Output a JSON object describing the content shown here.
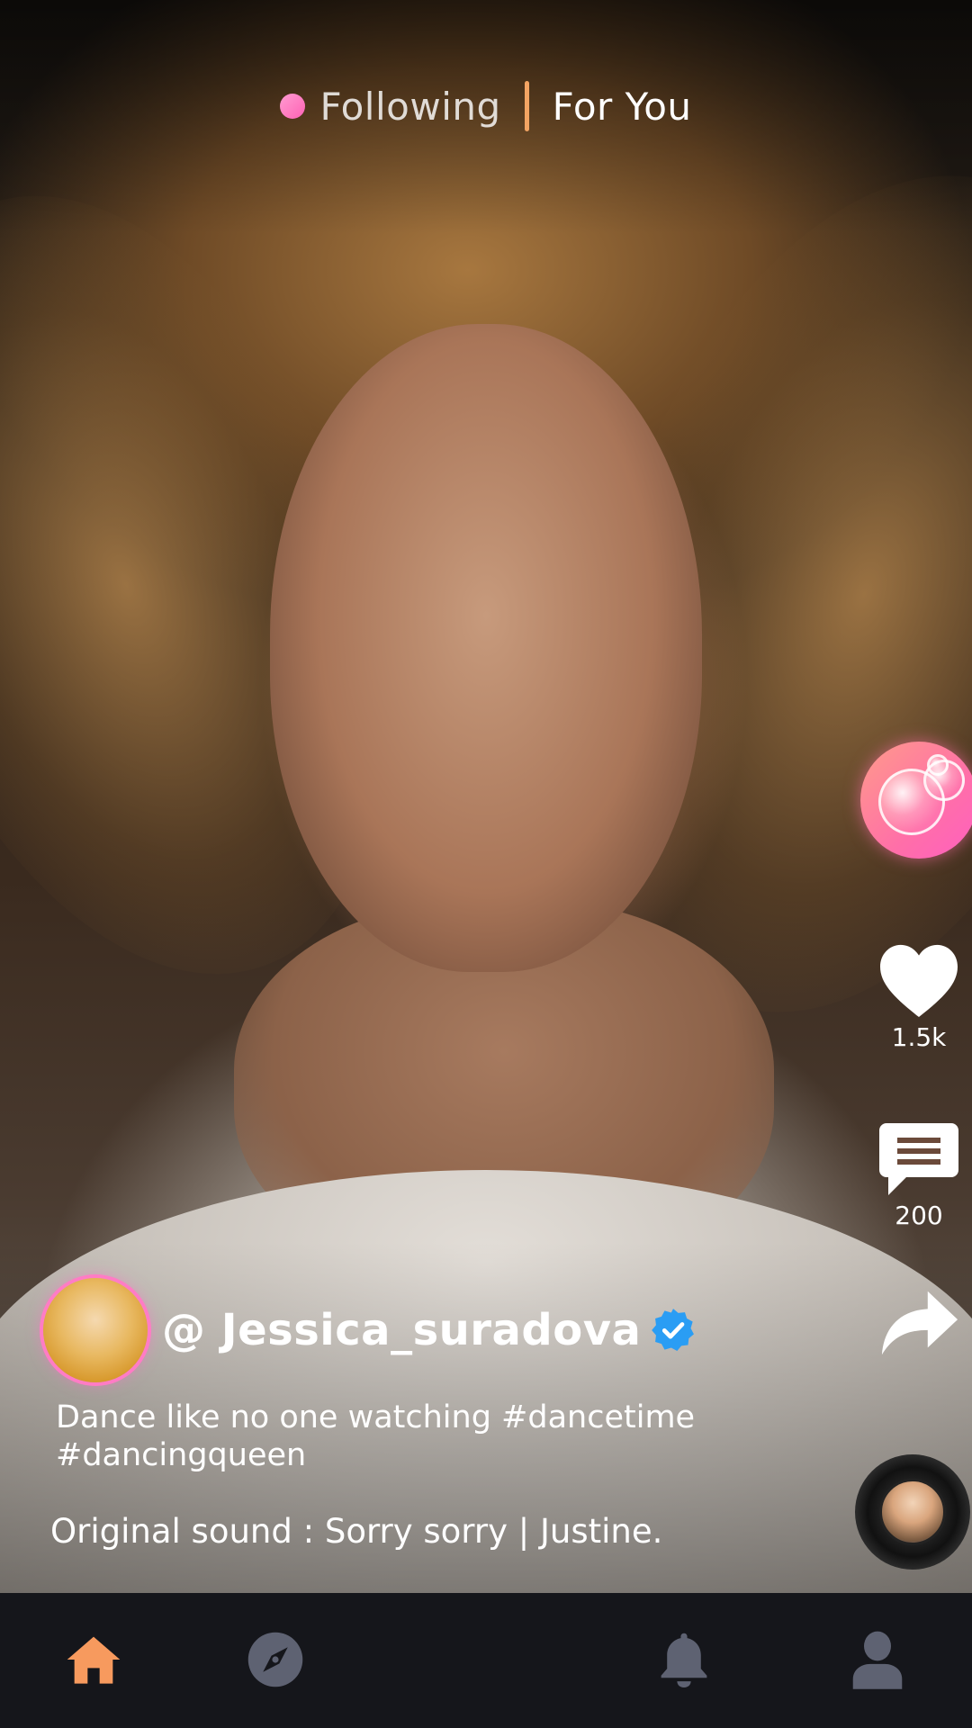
{
  "top_tabs": {
    "following_label": "Following",
    "for_you_label": "For You",
    "active_tab": "For You"
  },
  "actions": {
    "likes_count": "1.5k",
    "comments_count": "200"
  },
  "post": {
    "username": "@ Jessica_suradova",
    "verified": true,
    "caption_line1": "Dance like no one watching #dancetime",
    "caption_line2": "#dancingqueen",
    "sound": "Original sound : Sorry sorry | Justine."
  },
  "bottom_nav": {
    "items": [
      {
        "icon": "home-icon",
        "active": true
      },
      {
        "icon": "compass-icon",
        "active": false
      },
      {
        "icon": "bell-icon",
        "active": false
      },
      {
        "icon": "profile-icon",
        "active": false
      }
    ]
  },
  "colors": {
    "accent_orange": "#f3a463",
    "accent_pink": "#ff6fb8",
    "verified_blue": "#2a9df4",
    "nav_inactive": "#5e6272",
    "nav_bg": "#15161b"
  }
}
